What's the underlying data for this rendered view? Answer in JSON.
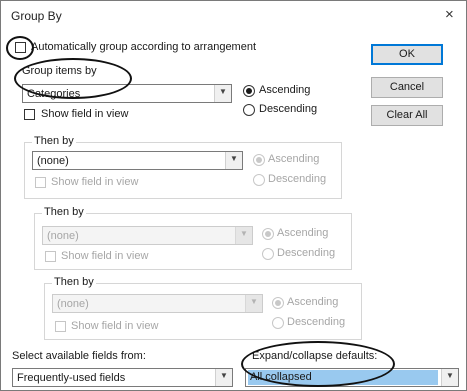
{
  "window": {
    "title": "Group By",
    "close_glyph": "×"
  },
  "auto_group": {
    "label": "Automatically group according to arrangement",
    "checked": false
  },
  "group_items_by": {
    "label": "Group items by",
    "value": "Categories",
    "show_field": "Show field in view",
    "ascending": "Ascending",
    "descending": "Descending",
    "order": "ascending"
  },
  "then_by_1": {
    "label": "Then by",
    "value": "(none)",
    "show_field": "Show field in view",
    "ascending": "Ascending",
    "descending": "Descending"
  },
  "then_by_2": {
    "label": "Then by",
    "value": "(none)",
    "show_field": "Show field in view",
    "ascending": "Ascending",
    "descending": "Descending"
  },
  "then_by_3": {
    "label": "Then by",
    "value": "(none)",
    "show_field": "Show field in view",
    "ascending": "Ascending",
    "descending": "Descending"
  },
  "buttons": {
    "ok": "OK",
    "cancel": "Cancel",
    "clear_all": "Clear All"
  },
  "available_fields": {
    "label": "Select available fields from:",
    "value": "Frequently-used fields"
  },
  "expand_collapse": {
    "label": "Expand/collapse defaults:",
    "value": "All collapsed",
    "highlight": "#99c9ef"
  },
  "icons": {
    "dropdown": "chevron-down-icon"
  }
}
